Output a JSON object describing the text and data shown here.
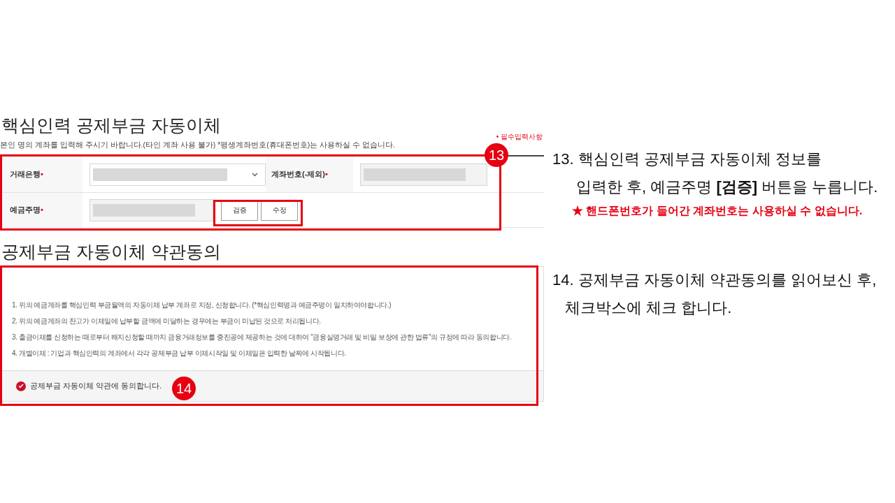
{
  "form_section": {
    "title": "핵심인력 공제부금 자동이체",
    "notice": "본인 명의 계좌를 입력해 주시기 바랍니다.(타인 계좌 사용 불가) *평생계좌번호(휴대폰번호)는 사용하실 수 없습니다.",
    "required_note": "• 필수입력사항",
    "required_symbol": "•",
    "step_badge": "13",
    "fields": [
      {
        "label": "거래은행",
        "kind": "select",
        "required": true
      },
      {
        "label": "계좌번호(-제외)",
        "kind": "text",
        "required": true
      },
      {
        "label": "예금주명",
        "kind": "text",
        "required": true,
        "buttons": [
          "검증",
          "수정"
        ]
      }
    ]
  },
  "terms_section": {
    "title": "공제부금 자동이체 약관동의",
    "step_badge": "14",
    "terms": [
      "1. 위의 예금계좌를 핵심인력 부금월액의 자동이체 납부 계좌로 지정, 신청합니다. (*핵심인력명과 예금주명이 일치하여야합니다.)",
      "2. 위의 예금계좌의 잔고가 이체일에 납부할 금액에 미달하는 경우에는 부금이 미납된 것으로 처리됩니다.",
      "3. 출금이체를 신청하는 때로부터 해지신청할 때까지 금융거래정보를 중진공에 제공하는 것에 대하여 \"금융실명거래 및 비밀 보장에 관한 법류\"의 규정에 따라 동의합니다.",
      "4. 개별이체 : 기업과 핵심인력의 계좌에서 각각 공제부금 납부 이체시작일 및 이체일은 입력한 날짜에 시작됩니다."
    ],
    "agree": {
      "label": "공제부금 자동이체 약관에 동의합니다.",
      "checked": true
    }
  },
  "instructions": [
    {
      "lines": [
        "13. 핵심인력 공제부금 자동이체 정보를",
        "입력한 후, 예금주명 **[검증]** 버튼을 누릅니다."
      ],
      "note": "★ 핸드폰번호가 들어간 계좌번호는 사용하실 수 없습니다."
    },
    {
      "lines": [
        "14. 공제부금 자동이체 약관동의를 읽어보신 후,",
        "체크박스에 체크 합니다."
      ]
    }
  ]
}
